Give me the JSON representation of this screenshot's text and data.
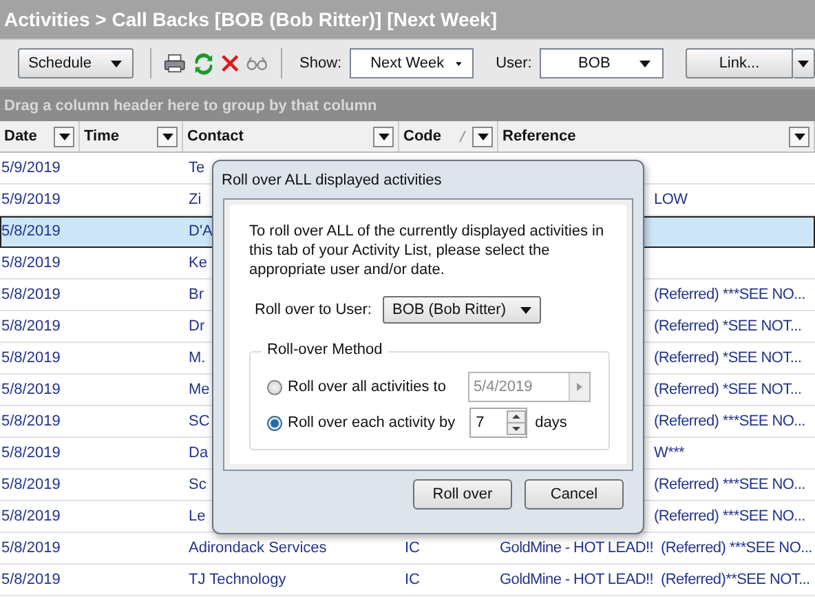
{
  "breadcrumb": "Activities > Call Backs [BOB (Bob Ritter)]  [Next Week]",
  "toolbar": {
    "schedule_button": "Schedule",
    "show_label": "Show:",
    "show_value": "Next Week",
    "user_label": "User:",
    "user_value": "BOB",
    "link_button": "Link..."
  },
  "group_hint": "Drag a column header here to group by that column",
  "columns": [
    {
      "label": "Date",
      "sorted": false
    },
    {
      "label": "Time",
      "sorted": false
    },
    {
      "label": "Contact",
      "sorted": false
    },
    {
      "label": "Code",
      "sorted": true
    },
    {
      "label": "Reference",
      "sorted": false
    }
  ],
  "rows": [
    {
      "date": "5/9/2019",
      "contact": "Te",
      "selected": false
    },
    {
      "date": "5/9/2019",
      "contact": "Zi",
      "reference": "LOW",
      "covered": true,
      "selected": false
    },
    {
      "date": "5/8/2019",
      "contact": "D'A",
      "selected": true
    },
    {
      "date": "5/8/2019",
      "contact": "Ke",
      "selected": false
    },
    {
      "date": "5/8/2019",
      "contact": "Br",
      "reference": "(Referred) ***SEE NO...",
      "covered": true,
      "selected": false
    },
    {
      "date": "5/8/2019",
      "contact": "Dr",
      "reference": "(Referred) *SEE NOT...",
      "covered": true,
      "selected": false
    },
    {
      "date": "5/8/2019",
      "contact": "M.",
      "reference": "(Referred) *SEE NOT...",
      "covered": true,
      "selected": false
    },
    {
      "date": "5/8/2019",
      "contact": "Me",
      "reference": "(Referred) *SEE NOT...",
      "covered": true,
      "selected": false
    },
    {
      "date": "5/8/2019",
      "contact": "SC",
      "reference": "(Referred) ***SEE NO...",
      "covered": true,
      "selected": false
    },
    {
      "date": "5/8/2019",
      "contact": "Da",
      "reference": "W***",
      "covered": true,
      "selected": false
    },
    {
      "date": "5/8/2019",
      "contact": "Sc",
      "reference": "(Referred) ***SEE NO...",
      "covered": true,
      "selected": false
    },
    {
      "date": "5/8/2019",
      "contact": "Le",
      "reference": "(Referred) ***SEE NO...",
      "covered": true,
      "selected": false
    },
    {
      "date": "5/8/2019",
      "contact": "Adirondack Services",
      "code": "IC",
      "reference": "GoldMine - HOT LEAD!!  (Referred) ***SEE NO...",
      "covered": false,
      "selected": false
    },
    {
      "date": "5/8/2019",
      "contact": "TJ Technology",
      "code": "IC",
      "reference": "GoldMine - HOT LEAD!!  (Referred)**SEE NOT...",
      "covered": false,
      "selected": false
    }
  ],
  "dialog": {
    "title": "Roll over ALL displayed activities",
    "message": "To roll over ALL of the currently displayed activities in this tab of your Activity List, please select the appropriate user and/or date.",
    "user_label": "Roll over to User:",
    "user_value": "BOB (Bob Ritter)",
    "group_title": "Roll-over Method",
    "options": [
      {
        "kind": "date",
        "label": "Roll over all activities to",
        "value": "5/4/2019",
        "selected": false
      },
      {
        "kind": "days",
        "label": "Roll over each activity by",
        "value": "7",
        "unit": "days",
        "selected": true
      }
    ],
    "buttons": [
      "Roll over",
      "Cancel"
    ]
  }
}
